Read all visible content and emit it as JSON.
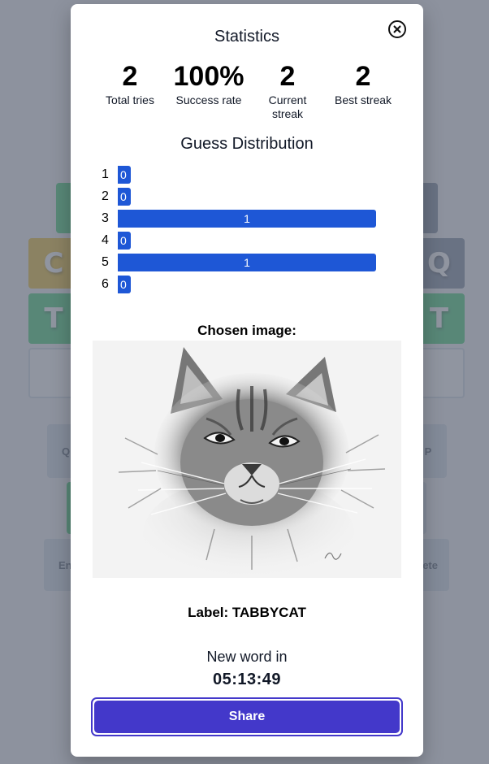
{
  "board": {
    "row1": [
      "",
      "",
      "",
      "",
      "",
      ""
    ],
    "row2": [
      "C",
      "",
      "",
      "",
      "",
      "Q"
    ],
    "row3": [
      "T",
      "",
      "",
      "",
      "",
      "T"
    ]
  },
  "keyboard": {
    "row1_first": "Q",
    "row1_last": "P",
    "enter": "En",
    "delete": "ete"
  },
  "modal": {
    "title": "Statistics",
    "stats": [
      {
        "value": "2",
        "label": "Total tries"
      },
      {
        "value": "100%",
        "label": "Success rate"
      },
      {
        "value": "2",
        "label": "Current streak"
      },
      {
        "value": "2",
        "label": "Best streak"
      }
    ],
    "distribution_title": "Guess Distribution",
    "distribution": [
      {
        "guess": "1",
        "count": 0
      },
      {
        "guess": "2",
        "count": 0
      },
      {
        "guess": "3",
        "count": 1
      },
      {
        "guess": "4",
        "count": 0
      },
      {
        "guess": "5",
        "count": 1
      },
      {
        "guess": "6",
        "count": 0
      }
    ],
    "chosen_image_label": "Chosen image:",
    "answer_label": "Label: TABBYCAT",
    "new_word_text": "New word in",
    "countdown": "05:13:49",
    "share_label": "Share"
  },
  "colors": {
    "bar": "#1e57d6",
    "share": "#4338ca",
    "tile_green": "#22c55e",
    "tile_yellow": "#eab308"
  }
}
